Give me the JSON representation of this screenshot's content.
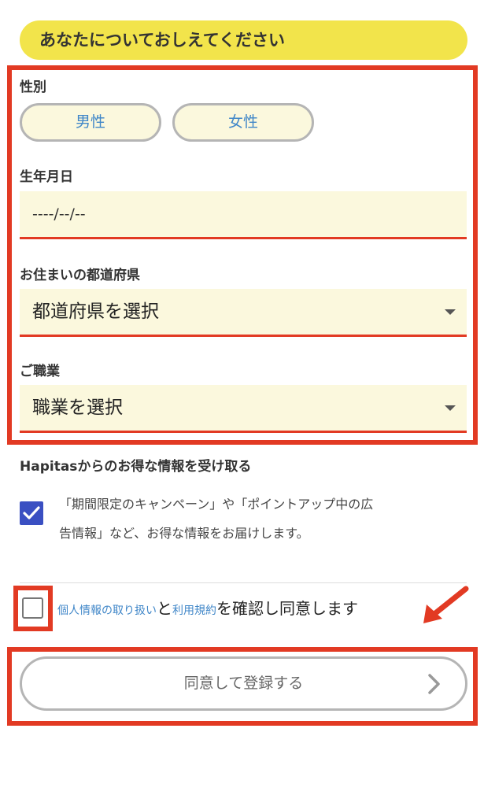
{
  "header": {
    "title": "あなたについておしえてください"
  },
  "gender": {
    "label": "性別",
    "options": [
      "男性",
      "女性"
    ]
  },
  "birthdate": {
    "label": "生年月日",
    "value": "----/--/--"
  },
  "prefecture": {
    "label": "お住まいの都道府県",
    "selected": "都道府県を選択"
  },
  "occupation": {
    "label": "ご職業",
    "selected": "職業を選択"
  },
  "newsletter": {
    "title": "Hapitasからのお得な情報を受け取る",
    "line1": "「期間限定のキャンペーン」や「ポイントアップ中の広",
    "line2": "告情報」など、お得な情報をお届けします。",
    "checked": true
  },
  "agreement": {
    "privacy_link": "個人情報の取り扱い",
    "connector": "と",
    "terms_link": "利用規約",
    "suffix": "を確認し同意します",
    "checked": false
  },
  "submit": {
    "label": "同意して登録する"
  },
  "icons": {
    "checkmark": "check-icon",
    "dropdown": "caret-down-icon",
    "chevron": "chevron-right-icon",
    "annotation": "arrow-icon"
  },
  "colors": {
    "header_bg": "#f2e44b",
    "field_bg": "#fbf8dd",
    "annotation_red": "#e23a23",
    "link_blue": "#3f86c8",
    "checkbox_blue": "#3a4fc2"
  }
}
